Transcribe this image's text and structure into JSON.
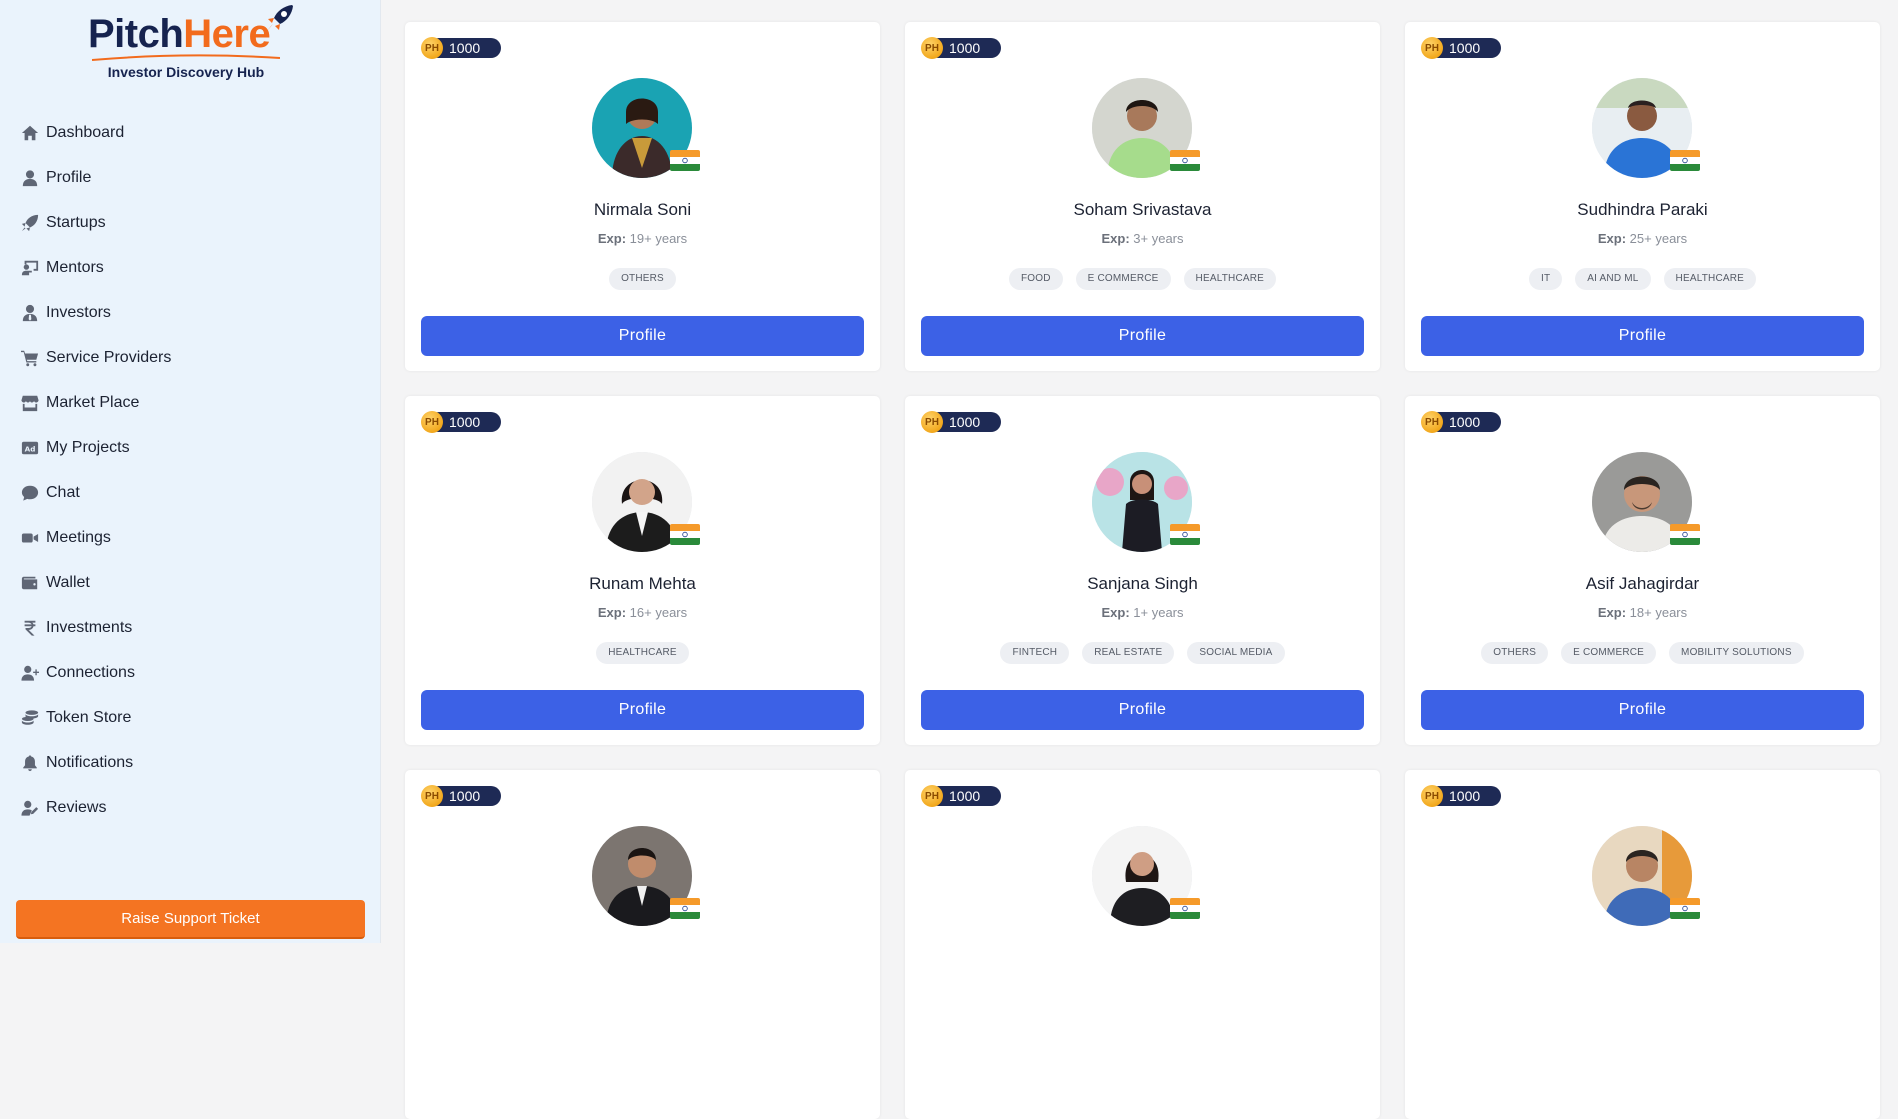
{
  "brand": {
    "name_part1": "Pitch",
    "name_part2": "Here",
    "subtitle": "Investor Discovery Hub",
    "colors": {
      "navy": "#16234f",
      "orange": "#f26b1d"
    }
  },
  "sidebar": {
    "items": [
      {
        "label": "Dashboard",
        "icon": "home-icon"
      },
      {
        "label": "Profile",
        "icon": "user-icon"
      },
      {
        "label": "Startups",
        "icon": "rocket-icon"
      },
      {
        "label": "Mentors",
        "icon": "chalkboard-teacher-icon"
      },
      {
        "label": "Investors",
        "icon": "user-tie-icon"
      },
      {
        "label": "Service Providers",
        "icon": "cart-icon"
      },
      {
        "label": "Market Place",
        "icon": "store-icon"
      },
      {
        "label": "My Projects",
        "icon": "ad-icon"
      },
      {
        "label": "Chat",
        "icon": "chat-bubble-icon"
      },
      {
        "label": "Meetings",
        "icon": "video-camera-icon"
      },
      {
        "label": "Wallet",
        "icon": "wallet-icon"
      },
      {
        "label": "Investments",
        "icon": "rupee-icon"
      },
      {
        "label": "Connections",
        "icon": "user-plus-icon"
      },
      {
        "label": "Token Store",
        "icon": "coins-icon"
      },
      {
        "label": "Notifications",
        "icon": "bell-icon"
      },
      {
        "label": "Reviews",
        "icon": "user-pen-icon"
      }
    ],
    "support_button": "Raise Support Ticket"
  },
  "cards": [
    {
      "token": "1000",
      "name": "Nirmala Soni",
      "exp_label": "Exp:",
      "exp_value": "19+ years",
      "tags": [
        "OTHERS"
      ],
      "button": "Profile"
    },
    {
      "token": "1000",
      "name": "Soham Srivastava",
      "exp_label": "Exp:",
      "exp_value": "3+ years",
      "tags": [
        "FOOD",
        "E COMMERCE",
        "HEALTHCARE"
      ],
      "button": "Profile"
    },
    {
      "token": "1000",
      "name": "Sudhindra Paraki",
      "exp_label": "Exp:",
      "exp_value": "25+ years",
      "tags": [
        "IT",
        "AI AND ML",
        "HEALTHCARE"
      ],
      "button": "Profile"
    },
    {
      "token": "1000",
      "name": "Runam Mehta",
      "exp_label": "Exp:",
      "exp_value": "16+ years",
      "tags": [
        "HEALTHCARE"
      ],
      "button": "Profile"
    },
    {
      "token": "1000",
      "name": "Sanjana Singh",
      "exp_label": "Exp:",
      "exp_value": "1+ years",
      "tags": [
        "FINTECH",
        "REAL ESTATE",
        "SOCIAL MEDIA"
      ],
      "button": "Profile"
    },
    {
      "token": "1000",
      "name": "Asif Jahagirdar",
      "exp_label": "Exp:",
      "exp_value": "18+ years",
      "tags": [
        "OTHERS",
        "E COMMERCE",
        "MOBILITY SOLUTIONS"
      ],
      "button": "Profile"
    },
    {
      "token": "1000"
    },
    {
      "token": "1000"
    },
    {
      "token": "1000"
    }
  ],
  "colors": {
    "primary_button": "#3c61e6",
    "support_button": "#f47422",
    "token_pill": "#1e2a55",
    "sidebar_bg": "#eaf3fc"
  }
}
